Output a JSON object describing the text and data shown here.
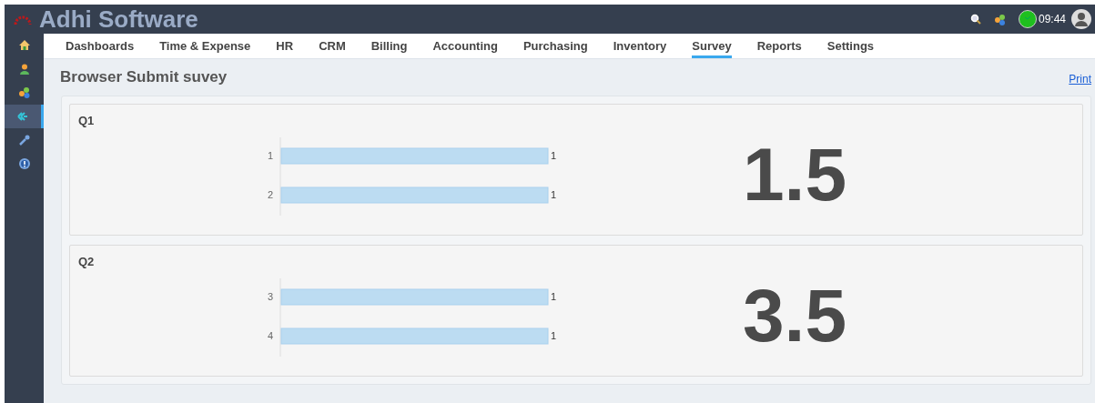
{
  "app": {
    "title": "Adhi Software",
    "time": "09:44"
  },
  "sidebar": {
    "items": [
      {
        "kind": "home",
        "selected": false
      },
      {
        "kind": "user",
        "selected": false
      },
      {
        "kind": "circles",
        "selected": false
      },
      {
        "kind": "survey",
        "selected": true
      },
      {
        "kind": "wrench",
        "selected": false
      },
      {
        "kind": "help",
        "selected": false
      }
    ]
  },
  "nav": {
    "tabs": [
      {
        "label": "Dashboards",
        "selected": false
      },
      {
        "label": "Time & Expense",
        "selected": false
      },
      {
        "label": "HR",
        "selected": false
      },
      {
        "label": "CRM",
        "selected": false
      },
      {
        "label": "Billing",
        "selected": false
      },
      {
        "label": "Accounting",
        "selected": false
      },
      {
        "label": "Purchasing",
        "selected": false
      },
      {
        "label": "Inventory",
        "selected": false
      },
      {
        "label": "Survey",
        "selected": true
      },
      {
        "label": "Reports",
        "selected": false
      },
      {
        "label": "Settings",
        "selected": false
      }
    ]
  },
  "page": {
    "title": "Browser Submit suvey",
    "print_link": "Print"
  },
  "questions": [
    {
      "title": "Q1",
      "average": "1.5",
      "chart_data": {
        "type": "bar",
        "orientation": "horizontal",
        "categories": [
          "1",
          "2"
        ],
        "series": [
          {
            "color": "#bcdcf2",
            "values": [
              1,
              1
            ]
          }
        ],
        "data_labels": true
      }
    },
    {
      "title": "Q2",
      "average": "3.5",
      "chart_data": {
        "type": "bar",
        "orientation": "horizontal",
        "categories": [
          "3",
          "4"
        ],
        "series": [
          {
            "color": "#bcdcf2",
            "values": [
              1,
              1
            ]
          }
        ],
        "data_labels": true
      }
    }
  ]
}
